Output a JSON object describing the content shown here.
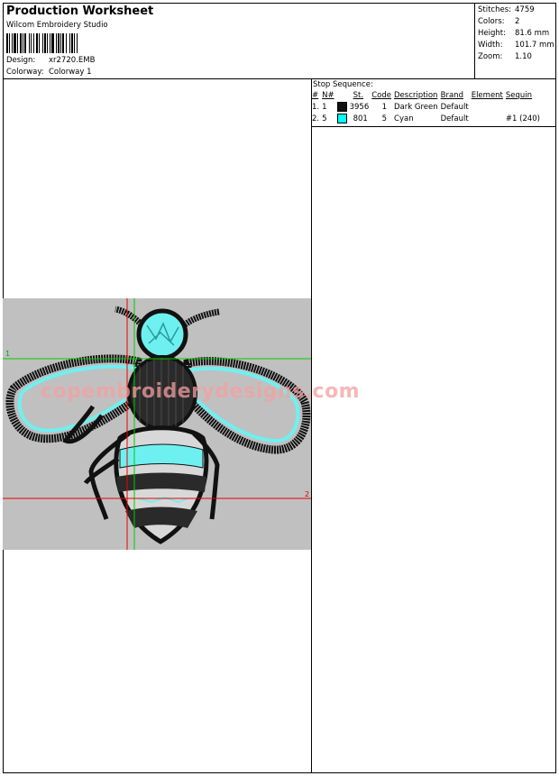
{
  "header": {
    "title": "Production Worksheet",
    "software": "Wilcom  Embroidery Studio",
    "design_label": "Design:",
    "design_value": "xr2720.EMB",
    "colorway_label": "Colorway:",
    "colorway_value": "Colorway 1"
  },
  "stats": [
    {
      "label": "Stitches:",
      "value": "4759"
    },
    {
      "label": "Colors:",
      "value": "2"
    },
    {
      "label": "Height:",
      "value": "81.6 mm"
    },
    {
      "label": "Width:",
      "value": "101.7 mm"
    },
    {
      "label": "Zoom:",
      "value": "1.10"
    }
  ],
  "stop_sequence": {
    "title": "Stop Sequence:",
    "columns": [
      "#",
      "N#",
      "St.",
      "Code",
      "Description",
      "Brand",
      "Element",
      "Sequin"
    ],
    "rows": [
      {
        "num": "1.",
        "n": "1",
        "color": "#111111",
        "st": "3956",
        "code": "1",
        "desc": "Dark Green",
        "brand": "Default",
        "element": "",
        "sequin": ""
      },
      {
        "num": "2.",
        "n": "5",
        "color": "#00ffff",
        "st": "801",
        "code": "5",
        "desc": "Cyan",
        "brand": "Default",
        "element": "",
        "sequin": "#1 (240)"
      }
    ]
  },
  "preview": {
    "watermark": "copembroiderydesigns.com",
    "marker_1": "1",
    "marker_2": "2",
    "colors": {
      "background": "#c0c0c0",
      "stitch_dark": "#111111",
      "stitch_cyan": "#6ff0f0",
      "guide_green": "#00cc00",
      "guide_red": "#ee0000"
    }
  }
}
